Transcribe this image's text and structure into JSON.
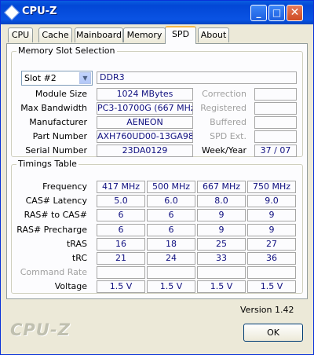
{
  "window": {
    "title": "CPU-Z"
  },
  "tabs": [
    "CPU",
    "Cache",
    "Mainboard",
    "Memory",
    "SPD",
    "About"
  ],
  "memory_slot": {
    "group_title": "Memory Slot Selection",
    "slot_value": "Slot #2",
    "type": "DDR3",
    "module_size_label": "Module Size",
    "module_size": "1024 MBytes",
    "max_bandwidth_label": "Max Bandwidth",
    "max_bandwidth": "PC3-10700G (667 MHz)",
    "manufacturer_label": "Manufacturer",
    "manufacturer": "AENEON",
    "part_number_label": "Part Number",
    "part_number": "AXH760UD00-13GA98X",
    "serial_number_label": "Serial Number",
    "serial_number": "23DA0129",
    "correction_label": "Correction",
    "registered_label": "Registered",
    "buffered_label": "Buffered",
    "spd_ext_label": "SPD Ext.",
    "week_year_label": "Week/Year",
    "week_year": "37 / 07"
  },
  "timings": {
    "group_title": "Timings Table",
    "rows": [
      {
        "label": "Frequency",
        "values": [
          "417 MHz",
          "500 MHz",
          "667 MHz",
          "750 MHz"
        ]
      },
      {
        "label": "CAS# Latency",
        "values": [
          "5.0",
          "6.0",
          "8.0",
          "9.0"
        ]
      },
      {
        "label": "RAS# to CAS#",
        "values": [
          "6",
          "6",
          "9",
          "9"
        ]
      },
      {
        "label": "RAS# Precharge",
        "values": [
          "6",
          "6",
          "9",
          "9"
        ]
      },
      {
        "label": "tRAS",
        "values": [
          "16",
          "18",
          "25",
          "27"
        ]
      },
      {
        "label": "tRC",
        "values": [
          "21",
          "24",
          "33",
          "36"
        ]
      },
      {
        "label": "Command Rate",
        "values": [
          "",
          "",
          "",
          ""
        ]
      },
      {
        "label": "Voltage",
        "values": [
          "1.5 V",
          "1.5 V",
          "1.5 V",
          "1.5 V"
        ]
      }
    ]
  },
  "footer": {
    "version": "Version 1.42",
    "logo": "CPU-Z",
    "ok_label": "OK"
  }
}
